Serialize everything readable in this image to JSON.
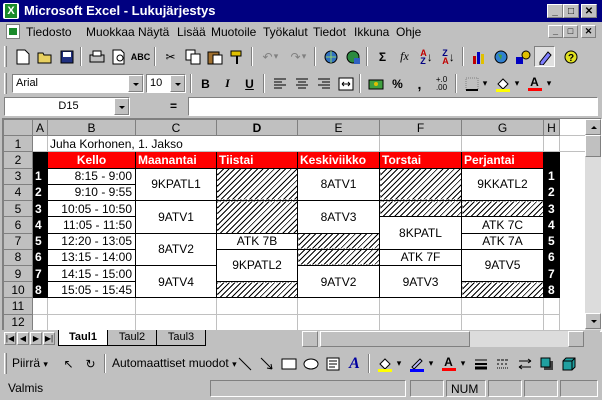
{
  "window": {
    "title": "Microsoft Excel - Lukujärjestys",
    "minimize_glyph": "_",
    "maximize_glyph": "□",
    "close_glyph": "✕"
  },
  "menu": {
    "items": [
      "Tiedosto",
      "Muokkaa",
      "Näytä",
      "Lisää",
      "Muotoile",
      "Työkalut",
      "Tiedot",
      "Ikkuna",
      "Ohje"
    ]
  },
  "toolbar_format": {
    "font": "Arial",
    "size": "10",
    "bold": "B",
    "italic": "I",
    "underline": "U",
    "percent": "%",
    "thousands": ",",
    "inc_decimals": "+.0\n.00"
  },
  "toolbar_standard": {
    "sum": "Σ",
    "function": "fx"
  },
  "formula_bar": {
    "name_box": "D15",
    "equals": "=",
    "content": ""
  },
  "sheet": {
    "columns": [
      "A",
      "B",
      "C",
      "D",
      "E",
      "F",
      "G",
      "H"
    ],
    "active_column": "D",
    "rows": [
      "1",
      "2",
      "3",
      "4",
      "5",
      "6",
      "7",
      "8",
      "9",
      "10",
      "11",
      "12"
    ],
    "title_cell": "Juha Korhonen, 1. Jakso",
    "header": [
      "Kello",
      "Maanantai",
      "Tiistai",
      "Keskiviikko",
      "Torstai",
      "Perjantai"
    ],
    "periods": [
      "1",
      "2",
      "3",
      "4",
      "5",
      "6",
      "7",
      "8"
    ],
    "times": [
      "8:15 - 9:00",
      "9:10 - 9:55",
      "10:05 - 10:50",
      "11:05 - 11:50",
      "12:20 - 13:05",
      "13:15 - 14:00",
      "14:15 - 15:00",
      "15:05 - 15:45"
    ],
    "mon": [
      "9KPATL1",
      "9ATV1",
      "8ATV2",
      "9ATV4"
    ],
    "tue": [
      "ATK 7B",
      "9KPATL2"
    ],
    "wed": [
      "8ATV1",
      "8ATV3",
      "9ATV2"
    ],
    "thu": [
      "8KPATL",
      "ATK 7F",
      "9ATV3"
    ],
    "fri": [
      "9KKATL2",
      "ATK 7C",
      "ATK 7A",
      "9ATV5"
    ]
  },
  "tabs": [
    "Taul1",
    "Taul2",
    "Taul3"
  ],
  "active_tab": "Taul1",
  "drawing_toolbar": {
    "draw": "Piirrä",
    "autoshapes": "Automaattiset muodot"
  },
  "status": {
    "text": "Valmis",
    "num": "NUM"
  }
}
